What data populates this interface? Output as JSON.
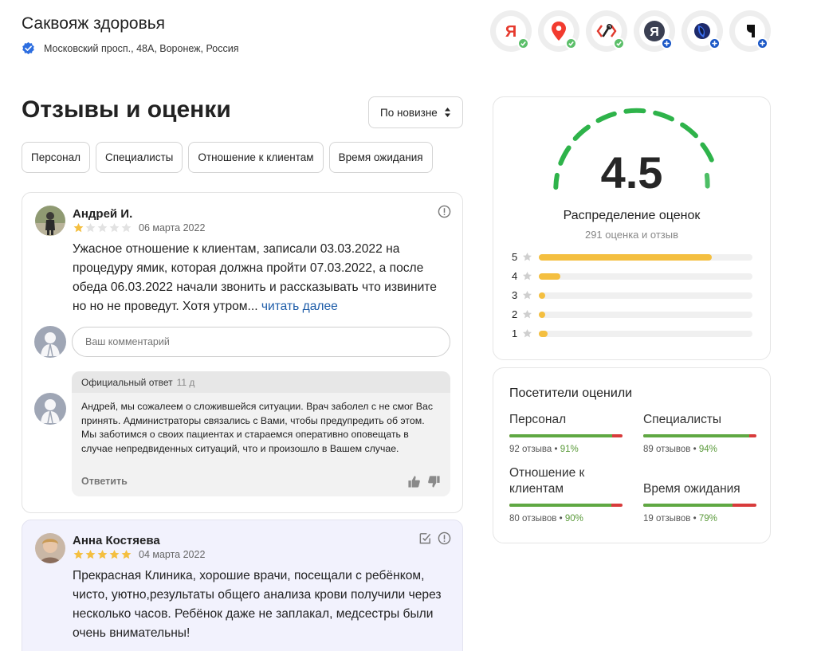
{
  "header": {
    "title": "Саквояж здоровья",
    "address": "Московский просп., 48А, Воронеж, Россия"
  },
  "services": [
    {
      "name": "yandex-service-icon",
      "status": "connected"
    },
    {
      "name": "maps-pin-service-icon",
      "status": "connected"
    },
    {
      "name": "dev-tools-service-icon",
      "status": "connected"
    },
    {
      "name": "yandex-round-service-icon",
      "status": "add"
    },
    {
      "name": "shield-service-icon",
      "status": "add"
    },
    {
      "name": "alpha-service-icon",
      "status": "add"
    }
  ],
  "reviews_section": {
    "title": "Отзывы и оценки",
    "sort_label": "По новизне",
    "filters": [
      "Персонал",
      "Специалисты",
      "Отношение к клиентам",
      "Время ожидания"
    ]
  },
  "reviews": [
    {
      "author": "Андрей И.",
      "rating": 1,
      "date": "06 марта 2022",
      "text": "Ужасное отношение к клиентам, записали 03.03.2022 на процедуру ямик, которая должна пройти 07.03.2022, а после обеда 06.03.2022 начали звонить и рассказывать что извините но но не проведут. Хотя утром...",
      "read_more": "читать далее",
      "comment_placeholder": "Ваш комментарий",
      "official_reply": {
        "label": "Официальный ответ",
        "ago": "11 д",
        "text": "Андрей, мы сожалеем о сложившейся ситуации. Врач заболел с не смог Вас принять. Администраторы связались с Вами, чтобы предупредить об этом. Мы заботимся о своих пациентах и стараемся оперативно оповещать в случае непредвиденных ситуаций, что и произошло в Вашем случае.",
        "reply_label": "Ответить"
      }
    },
    {
      "author": "Анна Костяева",
      "rating": 5,
      "date": "04 марта 2022",
      "text": "Прекрасная Клиника, хорошие врачи, посещали с ребёнком, чисто, уютно,результаты общего анализа крови получили через несколько часов. Ребёнок даже не заплакал, медсестры были очень внимательны!"
    }
  ],
  "rating": {
    "score": "4.5",
    "dist_title": "Распределение оценок",
    "dist_subtitle": "291 оценка и отзыв",
    "distribution": [
      {
        "stars": "5",
        "share": 0.81
      },
      {
        "stars": "4",
        "share": 0.1
      },
      {
        "stars": "3",
        "share": 0.01
      },
      {
        "stars": "2",
        "share": 0.01
      },
      {
        "stars": "1",
        "share": 0.04
      }
    ]
  },
  "visitors": {
    "title": "Посетители оценили",
    "items": [
      {
        "label": "Персонал",
        "count": "92 отзыва",
        "pct": "91%",
        "share": 0.91
      },
      {
        "label": "Специалисты",
        "count": "89 отзывов",
        "pct": "94%",
        "share": 0.94
      },
      {
        "label": "Отношение к клиентам",
        "count": "80 отзывов",
        "pct": "90%",
        "share": 0.9
      },
      {
        "label": "Время ожидания",
        "count": "19 отзывов",
        "pct": "79%",
        "share": 0.79
      }
    ]
  },
  "colors": {
    "accent_blue": "#1d5ca8",
    "star_gold": "#f4bf40",
    "gauge_green": "#2eb34a",
    "bar_green": "#5fa843",
    "bar_red": "#d83b3b",
    "verified_blue": "#2d6ee0"
  }
}
